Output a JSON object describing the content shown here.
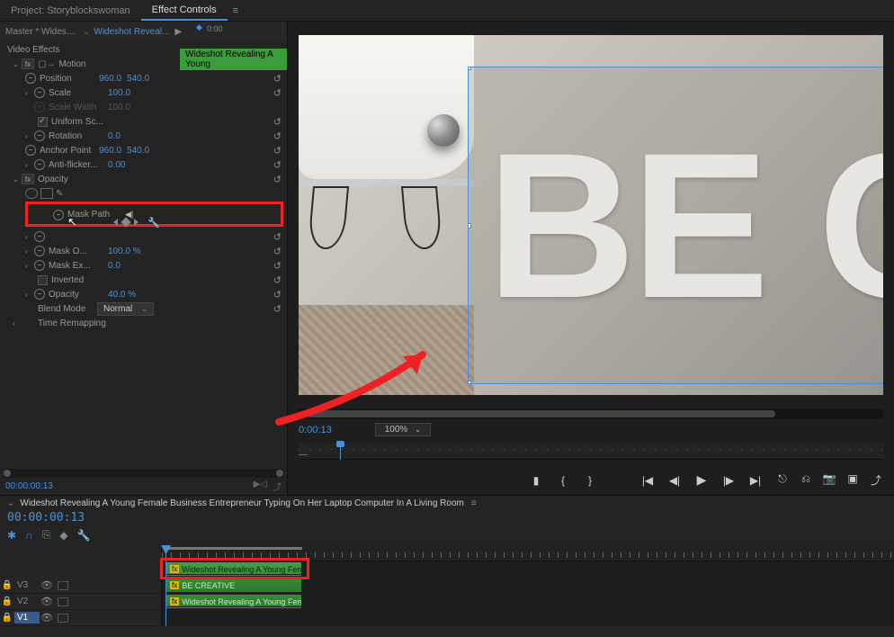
{
  "topbar": {
    "project_tab": "Project: Storyblockswoman",
    "effect_tab": "Effect Controls"
  },
  "tooltip": "Wideshot Revealing A Young",
  "ec": {
    "master": "Master * Wideshot...",
    "clip_link": "Wideshot Reveal...",
    "mini_tc": "0:00",
    "section": "Video Effects",
    "motion": "Motion",
    "position": "Position",
    "position_x": "960.0",
    "position_y": "540.0",
    "scale": "Scale",
    "scale_v": "100.0",
    "scale_width": "Scale Width",
    "scale_width_v": "100.0",
    "uniform": "Uniform Sc...",
    "rotation": "Rotation",
    "rotation_v": "0.0",
    "anchor": "Anchor Point",
    "anchor_x": "960.0",
    "anchor_y": "540.0",
    "antiflicker": "Anti-flicker...",
    "antiflicker_v": "0.00",
    "opacity_sec": "Opacity",
    "mask_path": "Mask Path",
    "mask_o": "Mask O...",
    "mask_o_v": "100.0 %",
    "mask_ex": "Mask Ex...",
    "mask_ex_v": "0.0",
    "inverted": "Inverted",
    "opacity": "Opacity",
    "opacity_v": "40.0 %",
    "blend": "Blend Mode",
    "blend_v": "Normal",
    "time_remap": "Time Remapping",
    "bottom_tc": "00:00:00:13"
  },
  "mon": {
    "big_text": "BE CR",
    "tc": "0:00:13",
    "zoom": "100%"
  },
  "seq": {
    "title": "Wideshot Revealing A Young Female Business Entrepreneur Typing On Her Laptop Computer In A Living Room",
    "tc": "00:00:00:13",
    "tracks": {
      "v3": "V3",
      "v2": "V2",
      "v1": "V1"
    },
    "clips": {
      "v3": "Wideshot Revealing A Young Female Busi",
      "v2": "BE CREATIVE",
      "v1": "Wideshot Revealing A Young Female Busi"
    }
  }
}
